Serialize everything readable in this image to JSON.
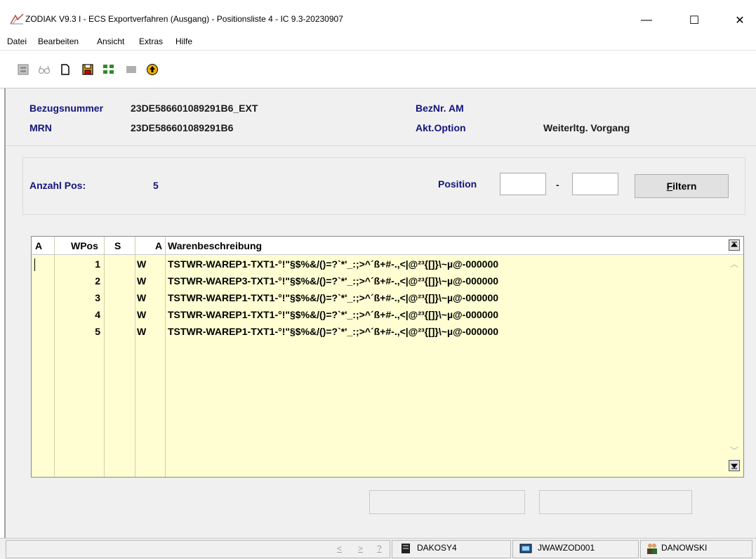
{
  "window": {
    "title": "ZODIAK V9.3 I - ECS Exportverfahren (Ausgang) - Positionsliste 4 - IC 9.3-20230907",
    "min": "—",
    "max": "☐",
    "close": "✕"
  },
  "menu": [
    "Datei",
    "Bearbeiten",
    "Ansicht",
    "Extras",
    "Hilfe"
  ],
  "toolbar": {
    "icons": [
      "print-icon",
      "glasses-icon",
      "new-document-icon",
      "save-icon",
      "tree-icon",
      "stop-icon",
      "export-arrow-icon"
    ]
  },
  "header": {
    "bezugsnummer_label": "Bezugsnummer",
    "bezugsnummer_value": "23DE586601089291B6_EXT",
    "mrn_label": "MRN",
    "mrn_value": "23DE586601089291B6",
    "beznr_label": "BezNr. AM",
    "akt_option_label": "Akt.Option",
    "akt_option_value": "Weiterltg. Vorgang"
  },
  "filter": {
    "anzahl_label": "Anzahl Pos:",
    "anzahl_value": "5",
    "position_label": "Position",
    "from_value": "",
    "dash": "-",
    "to_value": "",
    "button_prefix": "F",
    "button_rest": "iltern"
  },
  "grid": {
    "columns": [
      "A",
      "WPos",
      "S",
      "A",
      "Warenbeschreibung"
    ],
    "rows": [
      {
        "a": "",
        "wpos": "1",
        "s": "",
        "a2": "W",
        "desc": "TSTWR-WAREP1-TXT1-°!\"§$%&/()=?`*'_:;>^´ß+#-.,<|@²³{[]}\\~µ@-000000"
      },
      {
        "a": "",
        "wpos": "2",
        "s": "",
        "a2": "W",
        "desc": "TSTWR-WAREP3-TXT1-°!\"§$%&/()=?`*'_:;>^´ß+#-.,<|@²³{[]}\\~µ@-000000"
      },
      {
        "a": "",
        "wpos": "3",
        "s": "",
        "a2": "W",
        "desc": "TSTWR-WAREP1-TXT1-°!\"§$%&/()=?`*'_:;>^´ß+#-.,<|@²³{[]}\\~µ@-000000"
      },
      {
        "a": "",
        "wpos": "4",
        "s": "",
        "a2": "W",
        "desc": "TSTWR-WAREP1-TXT1-°!\"§$%&/()=?`*'_:;>^´ß+#-.,<|@²³{[]}\\~µ@-000000"
      },
      {
        "a": "",
        "wpos": "5",
        "s": "",
        "a2": "W",
        "desc": "TSTWR-WAREP1-TXT1-°!\"§$%&/()=?`*'_:;>^´ß+#-.,<|@²³{[]}\\~µ@-000000"
      }
    ]
  },
  "statusbar": {
    "nav_prev": "<",
    "nav_next": ">",
    "nav_help": "?",
    "system": "DAKOSY4",
    "workstation": "JWAWZOD001",
    "user": "DANOWSKI"
  },
  "colors": {
    "label_blue": "#14147d",
    "grid_yellow": "#fefed2",
    "panel_gray": "#f0f0f0"
  }
}
